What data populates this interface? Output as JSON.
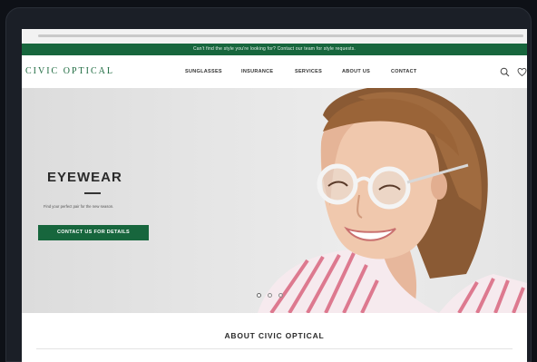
{
  "promo_bar": {
    "text": "Can't find the style you're looking for? Contact our team for style requests."
  },
  "nav": {
    "logo": "CIVIC OPTICAL",
    "links": [
      "SUNGLASSES",
      "INSURANCE",
      "SERVICES",
      "ABOUT US",
      "CONTACT"
    ],
    "icons": [
      "search-icon",
      "heart-icon"
    ]
  },
  "hero": {
    "title": "EYEWEAR",
    "subtitle": "Find your perfect pair for the new season.",
    "cta_label": "CONTACT US FOR DETAILS",
    "slides": 3,
    "active_slide": 1
  },
  "about": {
    "title": "ABOUT CIVIC OPTICAL"
  },
  "colors": {
    "brand_green": "#17663d",
    "device_bezel": "#1b1f27",
    "hero_bg": "#e4e4e4"
  }
}
